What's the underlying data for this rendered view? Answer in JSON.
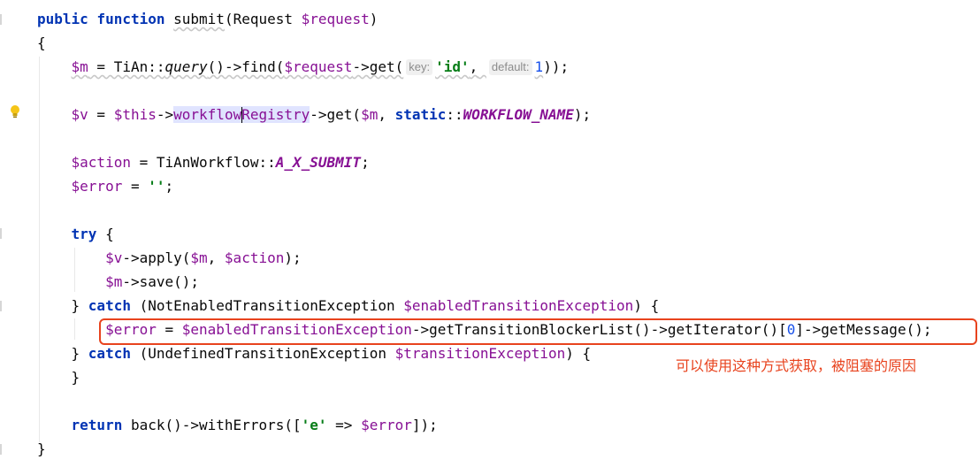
{
  "code": {
    "l1": {
      "kw1": "public",
      "kw2": "function",
      "fn": "submit",
      "rest": "(Request ",
      "param": "$request",
      "close": ")"
    },
    "l2": {
      "text": "{"
    },
    "l3": {
      "var": "$m",
      "eq": " = TiAn::",
      "method": "query",
      "mid": "()->find(",
      "req": "$request",
      "get": "->get(",
      "hint_key": "key:",
      "str": "'id'",
      "comma": ",",
      "hint_default": "default:",
      "num": "1",
      "end": "));"
    },
    "l4": {
      "var": "$v",
      "eq": " = ",
      "this": "$this",
      "arrow": "->",
      "prop": "workflowRegistry",
      "get": "->get(",
      "m": "$m",
      "comma": ", ",
      "static": "static",
      "colons": "::",
      "const": "WORKFLOW_NAME",
      "end": ");"
    },
    "l5": {
      "var": "$action",
      "eq": " = TiAnWorkflow::",
      "const": "A_X_SUBMIT",
      "end": ";"
    },
    "l6": {
      "var": "$error",
      "eq": " = ",
      "str": "''",
      "end": ";"
    },
    "l7": {
      "kw": "try",
      "rest": " {"
    },
    "l8": {
      "var": "$v",
      "mid": "->apply(",
      "m": "$m",
      "comma": ", ",
      "action": "$action",
      "end": ");"
    },
    "l9": {
      "var": "$m",
      "end": "->save();"
    },
    "l10": {
      "open": "} ",
      "kw": "catch",
      "mid": " (NotEnabledTransitionException ",
      "var": "$enabledTransitionException",
      "end": ") {"
    },
    "l11": {
      "var": "$error",
      "eq": " = ",
      "var2": "$enabledTransitionException",
      "mid": "->getTransitionBlockerList()->getIterator()[",
      "num": "0",
      "end": "]->getMessage();"
    },
    "l12": {
      "open": "} ",
      "kw": "catch",
      "mid": " (UndefinedTransitionException ",
      "var": "$transitionException",
      "end": ") {"
    },
    "l13": {
      "text": "}"
    },
    "l14": {
      "kw": "return",
      "mid": " back()->withErrors([",
      "str": "'e'",
      "arrow": " => ",
      "var": "$error",
      "end": "]);"
    },
    "l15": {
      "text": "}"
    }
  },
  "annotation": "可以使用这种方式获取，被阻塞的原因",
  "colors": {
    "keyword": "#0033b3",
    "variable": "#871094",
    "string": "#067d17",
    "number": "#1750eb",
    "highlight_box": "#e8431e"
  }
}
